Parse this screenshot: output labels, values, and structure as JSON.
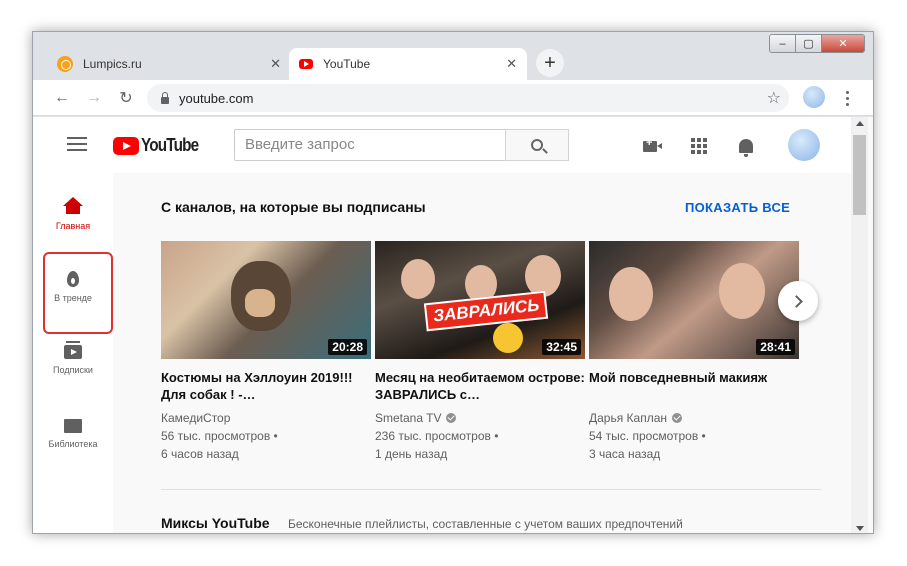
{
  "browser": {
    "tabs": [
      {
        "title": "Lumpics.ru",
        "close": "✕",
        "favicon": "lumpics-orange-icon"
      },
      {
        "title": "YouTube",
        "close": "✕",
        "favicon": "youtube-icon"
      }
    ],
    "new_tab": "+",
    "url": "youtube.com",
    "star": "☆",
    "nav": {
      "back": "←",
      "forward": "→",
      "reload": "↻"
    },
    "window_controls": {
      "min": "–",
      "max": "▢",
      "close": "✕"
    }
  },
  "youtube": {
    "logo_text": "YouTube",
    "search_placeholder": "Введите запрос",
    "sidebar": [
      {
        "label": "Главная",
        "icon": "home-icon"
      },
      {
        "label": "В тренде",
        "icon": "fire-icon"
      },
      {
        "label": "Подписки",
        "icon": "subscriptions-icon"
      },
      {
        "label": "Библиотека",
        "icon": "library-icon"
      }
    ],
    "section_title": "С каналов, на которые вы подписаны",
    "show_all": "ПОКАЗАТЬ ВСЕ",
    "videos": [
      {
        "title": "Костюмы на Хэллоуин 2019!!! Для собак ! -…",
        "channel": "КамедиСтор",
        "verified": false,
        "views": "56 тыс. просмотров •",
        "ago": "6 часов назад",
        "duration": "20:28"
      },
      {
        "title": "Месяц на необитаемом острове: ЗАВРАЛИСЬ с…",
        "channel": "Smetana TV",
        "verified": true,
        "views": "236 тыс. просмотров •",
        "ago": "1 день назад",
        "duration": "32:45",
        "badge": "ЗАВРАЛИСЬ"
      },
      {
        "title": "Мой повседневный макияж",
        "channel": "Дарья Каплан",
        "verified": true,
        "views": "54 тыс. просмотров •",
        "ago": "3 часа назад",
        "duration": "28:41"
      }
    ],
    "mix_title": "Миксы YouTube",
    "mix_subtitle": "Бесконечные плейлисты, составленные с учетом ваших предпочтений"
  },
  "colors": {
    "accent_red": "#ff0000",
    "link_blue": "#065fd4",
    "highlight_red": "#e03131"
  }
}
